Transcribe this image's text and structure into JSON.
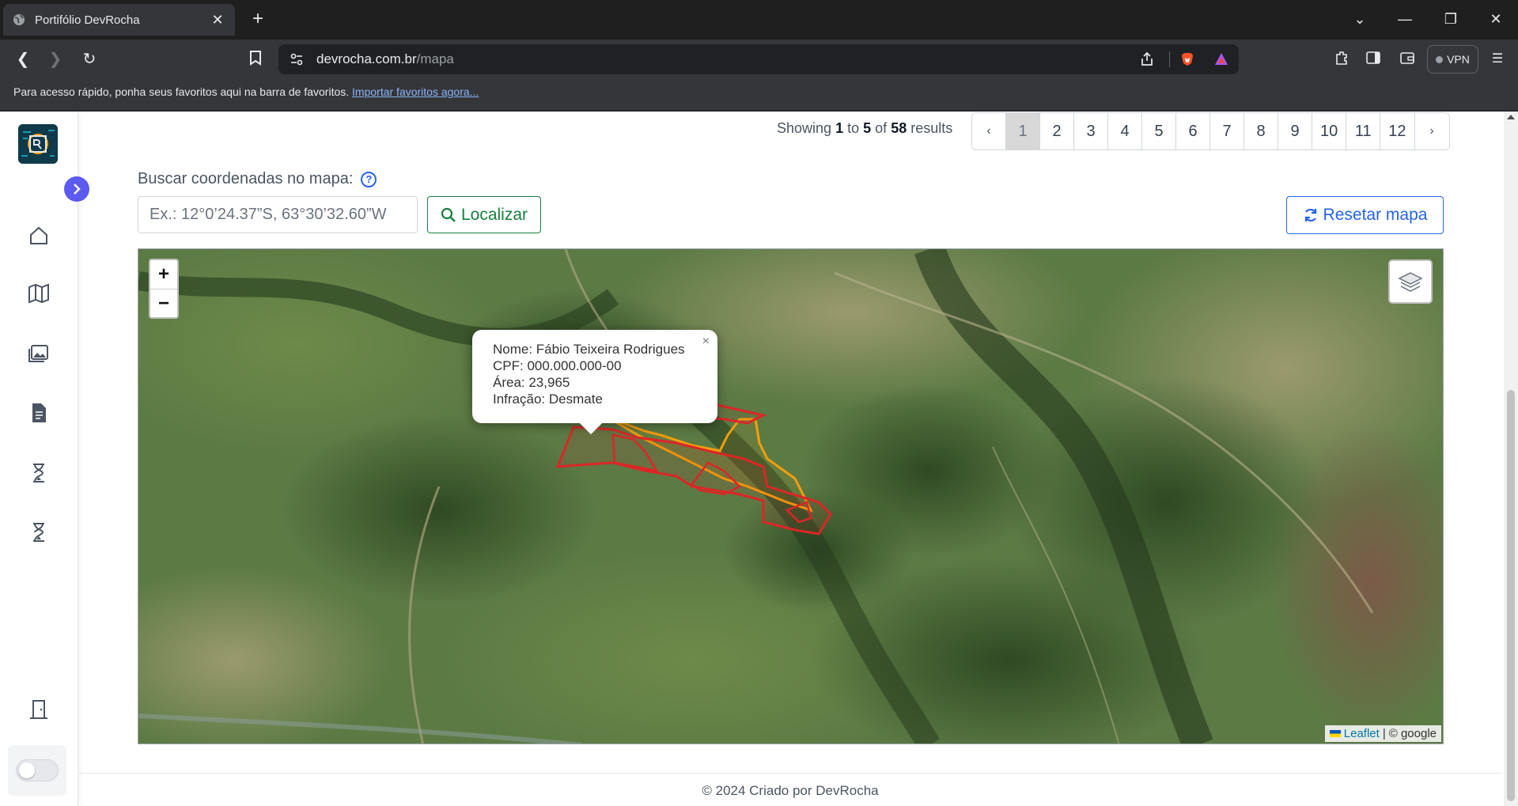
{
  "browser": {
    "tab_title": "Portifólio DevRocha",
    "url_host": "devrocha.com.br",
    "url_path": "/mapa",
    "vpn_label": "VPN",
    "bookmarks_text": "Para acesso rápido, ponha seus favoritos aqui na barra de favoritos.",
    "bookmarks_link": "Importar favoritos agora..."
  },
  "results": {
    "prefix": "Showing",
    "from": "1",
    "to_word": "to",
    "to": "5",
    "of_word": "of",
    "total": "58",
    "suffix": "results"
  },
  "pagination": {
    "prev": "‹",
    "next": "›",
    "active": "1",
    "pages": [
      "1",
      "2",
      "3",
      "4",
      "5",
      "6",
      "7",
      "8",
      "9",
      "10",
      "11",
      "12"
    ]
  },
  "search": {
    "label": "Buscar coordenadas no mapa:",
    "help_icon": "question-circle-icon",
    "placeholder": "Ex.: 12°0’24.37”S, 63°30’32.60”W",
    "button_label": "Localizar",
    "reset_label": "Resetar mapa"
  },
  "map": {
    "zoom_in": "+",
    "zoom_out": "−",
    "popup": {
      "nome": "Nome: Fábio Teixeira Rodrigues",
      "cpf": "CPF: 000.000.000-00",
      "area": "Área: 23,965",
      "infracao": "Infração: Desmate",
      "close": "×"
    },
    "attribution_leaflet": "Leaflet",
    "attribution_sep": "|",
    "attribution_source": "© google",
    "colors": {
      "polygon_orange": "#f59e0b",
      "polygon_red": "#dc2626"
    }
  },
  "sidebar": {
    "items": [
      "home-icon",
      "map-icon",
      "images-icon",
      "document-icon",
      "hourglass-icon",
      "hourglass-icon",
      "logout-door-icon"
    ]
  },
  "footer": {
    "text": "© 2024 Criado por DevRocha"
  },
  "colors": {
    "accent_blue": "#2563eb",
    "accent_green": "#15803d",
    "expand_purple": "#5b5bf0"
  }
}
